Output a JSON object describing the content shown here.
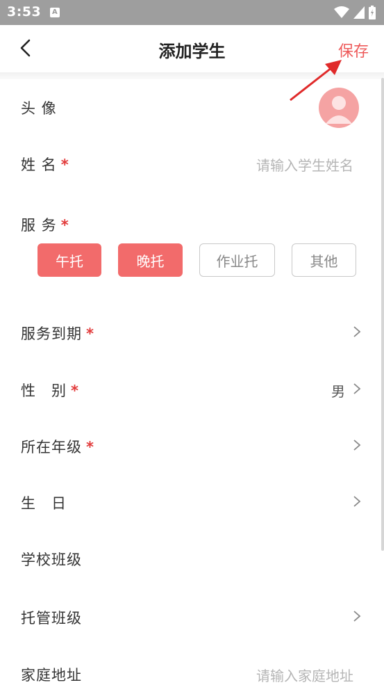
{
  "status_bar": {
    "time": "3:53",
    "notification_letter": "A"
  },
  "nav": {
    "title": "添加学生",
    "save_label": "保存"
  },
  "form": {
    "avatar_label": "头 像",
    "name_label": "姓 名",
    "name_placeholder": "请输入学生姓名",
    "service_label": "服 务",
    "services": [
      {
        "label": "午托",
        "selected": true
      },
      {
        "label": "晚托",
        "selected": true
      },
      {
        "label": "作业托",
        "selected": false
      },
      {
        "label": "其他",
        "selected": false
      }
    ],
    "service_expiry_label": "服务到期",
    "gender_label": "性　别",
    "gender_value": "男",
    "grade_label": "所在年级",
    "birthday_label": "生　日",
    "school_class_label": "学校班级",
    "care_class_label": "托管班级",
    "address_label": "家庭地址",
    "address_placeholder": "请输入家庭地址",
    "required_mark": "*"
  },
  "colors": {
    "accent": "#f26b6b",
    "required": "#e23b3b",
    "status_bar": "#9e9e9e"
  }
}
